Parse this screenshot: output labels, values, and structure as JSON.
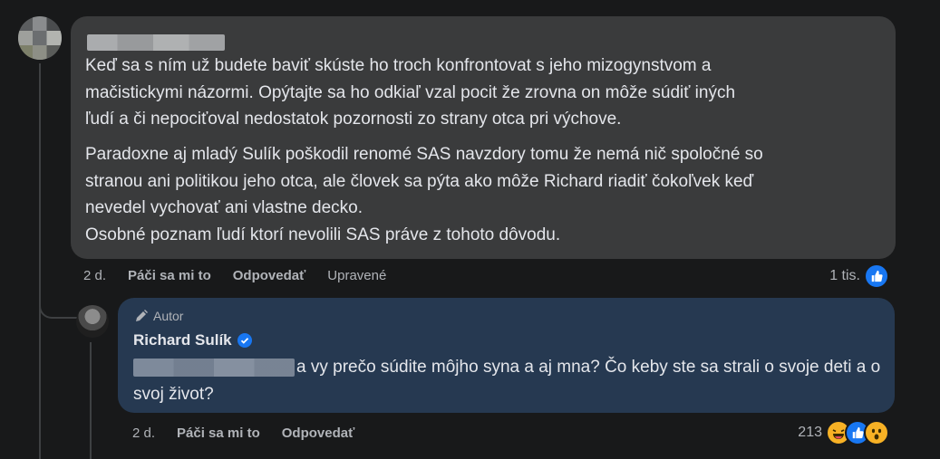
{
  "comment": {
    "paragraph1": "Keď sa s ním už budete baviť skúste ho troch konfrontovat s jeho mizogynstvom a\nmačistickymi názormi. Opýtajte sa ho odkiaľ vzal pocit že zrovna on môže súdiť iných\nľudí a či nepociťoval nedostatok pozornosti zo strany otca pri výchove.",
    "paragraph2": "Paradoxne aj mladý Sulík poškodil renomé SAS navzdory tomu že nemá nič spoločné so\nstranou ani politikou jeho otca, ale človek sa pýta ako môže Richard riadiť čokoľvek keď\nnevedel vychovať ani vlastne decko.\nOsobné poznam ľudí ktorí nevolili SAS práve z tohoto dôvodu.",
    "time": "2 d.",
    "like_label": "Páči sa mi to",
    "reply_label": "Odpovedať",
    "edited_label": "Upravené",
    "reaction_count": "1 tis."
  },
  "reply": {
    "author_badge": "Autor",
    "author_name": "Richard Sulík",
    "text": "a vy prečo súdite môjho syna a aj mna? Čo keby ste sa strali o svoje deti a o svoj život?",
    "time": "2 d.",
    "like_label": "Páči sa mi to",
    "reply_label": "Odpovedať",
    "reaction_count": "213"
  },
  "colors": {
    "page_bg": "#18191a",
    "comment_bubble": "#3a3b3c",
    "author_bubble": "#263951",
    "like_blue": "#1877f2",
    "emoji_yellow": "#f7b125"
  },
  "icons": {
    "comment_reactions": [
      "like-icon"
    ],
    "reply_reactions": [
      "haha-icon",
      "like-icon",
      "wow-icon"
    ]
  }
}
